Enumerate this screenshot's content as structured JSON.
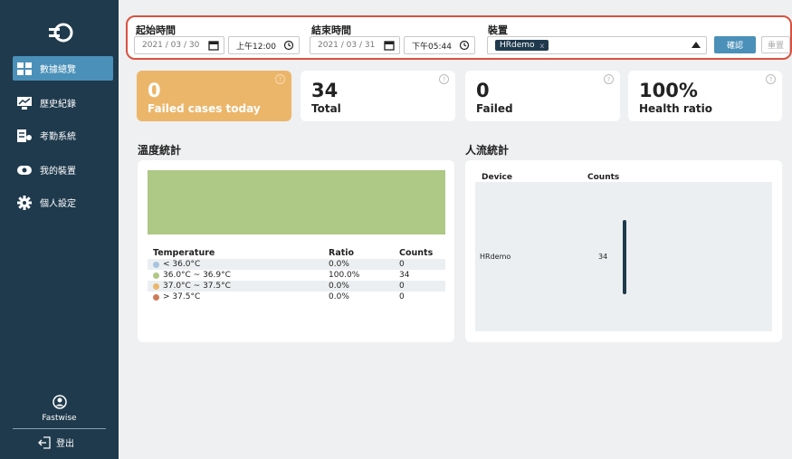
{
  "sidebar": {
    "items": [
      {
        "label": "數據總覽",
        "icon": "dashboard-icon",
        "active": true
      },
      {
        "label": "歷史紀錄",
        "icon": "history-icon",
        "active": false
      },
      {
        "label": "考勤系統",
        "icon": "attendance-icon",
        "active": false
      },
      {
        "label": "我的裝置",
        "icon": "device-icon",
        "active": false
      },
      {
        "label": "個人設定",
        "icon": "gear-icon",
        "active": false
      }
    ],
    "user_name": "Fastwise",
    "logout_label": "登出"
  },
  "filter": {
    "start_label": "起始時間",
    "start_date": "2021 / 03 / 30",
    "start_time": "上午12:00",
    "end_label": "結束時間",
    "end_date": "2021 / 03 / 31",
    "end_time": "下午05:44",
    "device_label": "裝置",
    "device_tag": "HRdemo",
    "device_tag_remove": "x",
    "confirm_label": "確認",
    "reset_label": "重置"
  },
  "stats": [
    {
      "value": "0",
      "label": "Failed cases today",
      "help": "?"
    },
    {
      "value": "34",
      "label": "Total",
      "help": "?"
    },
    {
      "value": "0",
      "label": "Failed",
      "help": "?"
    },
    {
      "value": "100%",
      "label": "Health ratio",
      "help": "?"
    }
  ],
  "temperature": {
    "title": "溫度統計",
    "headers": [
      "Temperature",
      "Ratio",
      "Counts"
    ],
    "rows": [
      {
        "range": "< 36.0°C",
        "ratio": "0.0%",
        "counts": "0",
        "color": "#a8c4e0"
      },
      {
        "range": "36.0°C ~ 36.9°C",
        "ratio": "100.0%",
        "counts": "34",
        "color": "#aec885"
      },
      {
        "range": "37.0°C ~ 37.5°C",
        "ratio": "0.0%",
        "counts": "0",
        "color": "#ecb66a"
      },
      {
        "range": "> 37.5°C",
        "ratio": "0.0%",
        "counts": "0",
        "color": "#d07a5c"
      }
    ]
  },
  "traffic": {
    "title": "人流統計",
    "headers": [
      "Device",
      "Counts"
    ],
    "rows": [
      {
        "device": "HRdemo",
        "counts": "34"
      }
    ]
  }
}
